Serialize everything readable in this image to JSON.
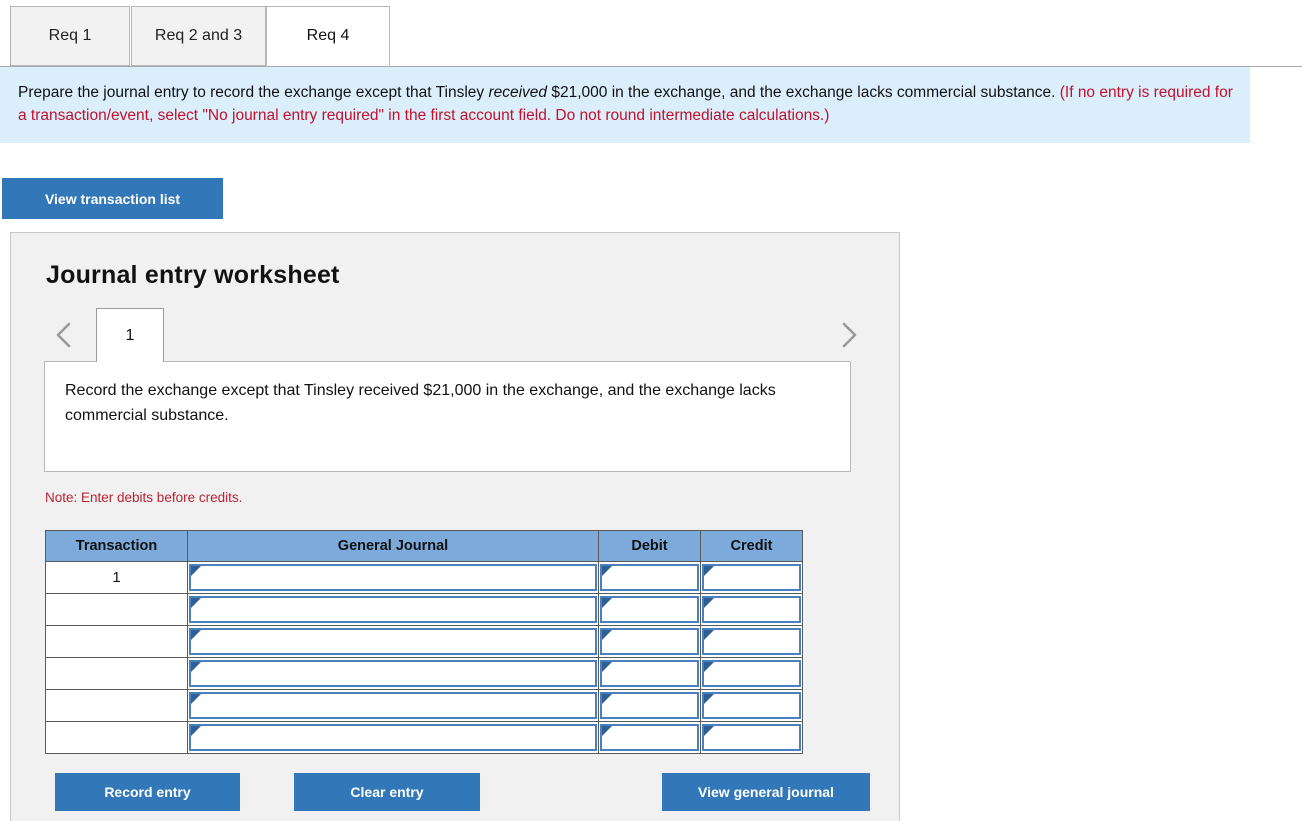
{
  "tabs": [
    {
      "label": "Req 1",
      "active": false
    },
    {
      "label": "Req 2 and 3",
      "active": false
    },
    {
      "label": "Req 4",
      "active": true
    }
  ],
  "instruction": {
    "part1": "Prepare the journal entry to record the exchange except that Tinsley ",
    "emphasis": "received",
    "part2": " $21,000 in the exchange, and the exchange lacks commercial substance. ",
    "red": "(If no entry is required for a transaction/event, select \"No journal entry required\" in the first account field. Do not round intermediate calculations.)"
  },
  "toolbar": {
    "view_transaction_list_label": "View transaction list"
  },
  "worksheet": {
    "title": "Journal entry worksheet",
    "pager": {
      "prev_icon": "chevron-left-icon",
      "next_icon": "chevron-right-icon",
      "current_page": "1"
    },
    "description": "Record the exchange except that Tinsley received $21,000 in the exchange, and the exchange lacks commercial substance.",
    "note": "Note: Enter debits before credits.",
    "table": {
      "headers": [
        "Transaction",
        "General Journal",
        "Debit",
        "Credit"
      ],
      "rows": [
        {
          "transaction": "1",
          "general_journal": "",
          "debit": "",
          "credit": ""
        },
        {
          "transaction": "",
          "general_journal": "",
          "debit": "",
          "credit": ""
        },
        {
          "transaction": "",
          "general_journal": "",
          "debit": "",
          "credit": ""
        },
        {
          "transaction": "",
          "general_journal": "",
          "debit": "",
          "credit": ""
        },
        {
          "transaction": "",
          "general_journal": "",
          "debit": "",
          "credit": ""
        },
        {
          "transaction": "",
          "general_journal": "",
          "debit": "",
          "credit": ""
        }
      ]
    },
    "buttons": {
      "record_entry": "Record entry",
      "clear_entry": "Clear entry",
      "view_general_journal": "View general journal"
    }
  },
  "colors": {
    "button_blue": "#3277b8",
    "header_blue": "#7cabdb",
    "panel_blue": "#dbeefc",
    "red_text": "#c0122b",
    "input_border": "#4a80bd"
  }
}
